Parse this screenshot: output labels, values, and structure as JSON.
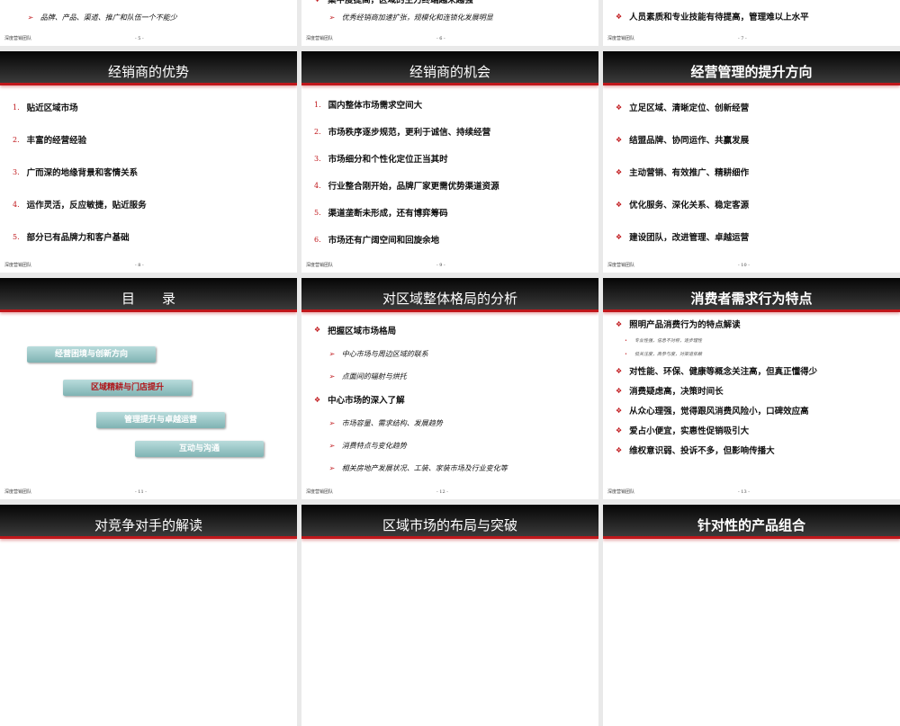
{
  "footer_text": "深度营销团队",
  "slides": [
    {
      "title": "",
      "page": "- 5 -",
      "layout": "tail",
      "items": [
        {
          "level": 2,
          "marker": "➢",
          "text": "品牌、产品、渠道、推广和队伍一个不能少"
        }
      ]
    },
    {
      "title": "",
      "page": "- 6 -",
      "layout": "tail",
      "items": [
        {
          "level": 1,
          "marker": "❖",
          "text": "集中度提高，区域的主力终端越来越强"
        },
        {
          "level": 2,
          "marker": "➢",
          "text": "优秀经销商加速扩张，规模化和连锁化发展明显"
        }
      ]
    },
    {
      "title": "",
      "page": "- 7 -",
      "layout": "tail",
      "items": [
        {
          "level": 1,
          "marker": "❖",
          "text": "人员素质和专业技能有待提高，管理难以上水平"
        }
      ]
    },
    {
      "title": "经销商的优势",
      "page": "- 8 -",
      "layout": "list",
      "items": [
        {
          "level": 1,
          "marker": "1.",
          "text": "贴近区域市场"
        },
        {
          "level": 1,
          "marker": "2.",
          "text": "丰富的经营经验"
        },
        {
          "level": 1,
          "marker": "3.",
          "text": "广而深的地缘背景和客情关系"
        },
        {
          "level": 1,
          "marker": "4.",
          "text": "运作灵活，反应敏捷，贴近服务"
        },
        {
          "level": 1,
          "marker": "5.",
          "text": "部分已有品牌力和客户基础"
        }
      ]
    },
    {
      "title": "经销商的机会",
      "page": "- 9 -",
      "layout": "list",
      "items": [
        {
          "level": 1,
          "marker": "1.",
          "text": "国内整体市场需求空间大"
        },
        {
          "level": 1,
          "marker": "2.",
          "text": "市场秩序逐步规范，更利于诚信、持续经营"
        },
        {
          "level": 1,
          "marker": "3.",
          "text": "市场细分和个性化定位正当其时"
        },
        {
          "level": 1,
          "marker": "4.",
          "text": "行业整合刚开始，品牌厂家更需优势渠道资源"
        },
        {
          "level": 1,
          "marker": "5.",
          "text": "渠道垄断未形成，还有博弈筹码"
        },
        {
          "level": 1,
          "marker": "6.",
          "text": "市场还有广阔空间和回旋余地"
        }
      ]
    },
    {
      "title": "经营管理的提升方向",
      "page": "- 10 -",
      "layout": "list",
      "items": [
        {
          "level": 1,
          "marker": "❖",
          "text": "立足区域、清晰定位、创新经营"
        },
        {
          "level": 1,
          "marker": "❖",
          "text": "结盟品牌、协同运作、共赢发展"
        },
        {
          "level": 1,
          "marker": "❖",
          "text": "主动营销、有效推广、精耕细作"
        },
        {
          "level": 1,
          "marker": "❖",
          "text": "优化服务、深化关系、稳定客源"
        },
        {
          "level": 1,
          "marker": "❖",
          "text": "建设团队，改进管理、卓越运营"
        }
      ]
    },
    {
      "title": "目　　录",
      "page": "- 11 -",
      "layout": "toc",
      "items": [
        {
          "text": "经营困境与创新方向",
          "active": false
        },
        {
          "text": "区域精耕与门店提升",
          "active": true
        },
        {
          "text": "管理提升与卓越运营",
          "active": false
        },
        {
          "text": "互动与沟通",
          "active": false
        }
      ]
    },
    {
      "title": "对区域整体格局的分析",
      "page": "- 12 -",
      "layout": "list",
      "items": [
        {
          "level": 1,
          "marker": "❖",
          "text": "把握区域市场格局"
        },
        {
          "level": 2,
          "marker": "➢",
          "text": "中心市场与周边区域的联系"
        },
        {
          "level": 2,
          "marker": "➢",
          "text": "点面间的辐射与烘托"
        },
        {
          "level": 1,
          "marker": "❖",
          "text": "中心市场的深入了解"
        },
        {
          "level": 2,
          "marker": "➢",
          "text": "市场容量、需求结构、发展趋势"
        },
        {
          "level": 2,
          "marker": "➢",
          "text": "消费特点与变化趋势"
        },
        {
          "level": 2,
          "marker": "➢",
          "text": "相关房地产发展状况、工装、家装市场及行业变化等"
        }
      ]
    },
    {
      "title": "消费者需求行为特点",
      "page": "- 13 -",
      "layout": "dense",
      "items": [
        {
          "level": 1,
          "marker": "❖",
          "text": "照明产品消费行为的特点解读"
        },
        {
          "level": 3,
          "marker": "•",
          "text": "专业性强，信息不对称，逐步理性"
        },
        {
          "level": 3,
          "marker": "•",
          "text": "低关注度，高参与度，对渠道依赖"
        },
        {
          "level": 1,
          "marker": "❖",
          "text": "对性能、环保、健康等概念关注高，但真正懂得少"
        },
        {
          "level": 1,
          "marker": "❖",
          "text": "消费疑虑高，决策时间长"
        },
        {
          "level": 1,
          "marker": "❖",
          "text": "从众心理强，觉得跟风消费风险小，口碑效应高"
        },
        {
          "level": 1,
          "marker": "❖",
          "text": "爱占小便宜，实惠性促销吸引大"
        },
        {
          "level": 1,
          "marker": "❖",
          "text": "维权意识弱、投诉不多，但影响传播大"
        }
      ]
    },
    {
      "title": "对竞争对手的解读",
      "page": "",
      "layout": "none",
      "items": []
    },
    {
      "title": "区域市场的布局与突破",
      "page": "",
      "layout": "none",
      "items": []
    },
    {
      "title": "针对性的产品组合",
      "page": "",
      "layout": "none",
      "items": []
    }
  ]
}
